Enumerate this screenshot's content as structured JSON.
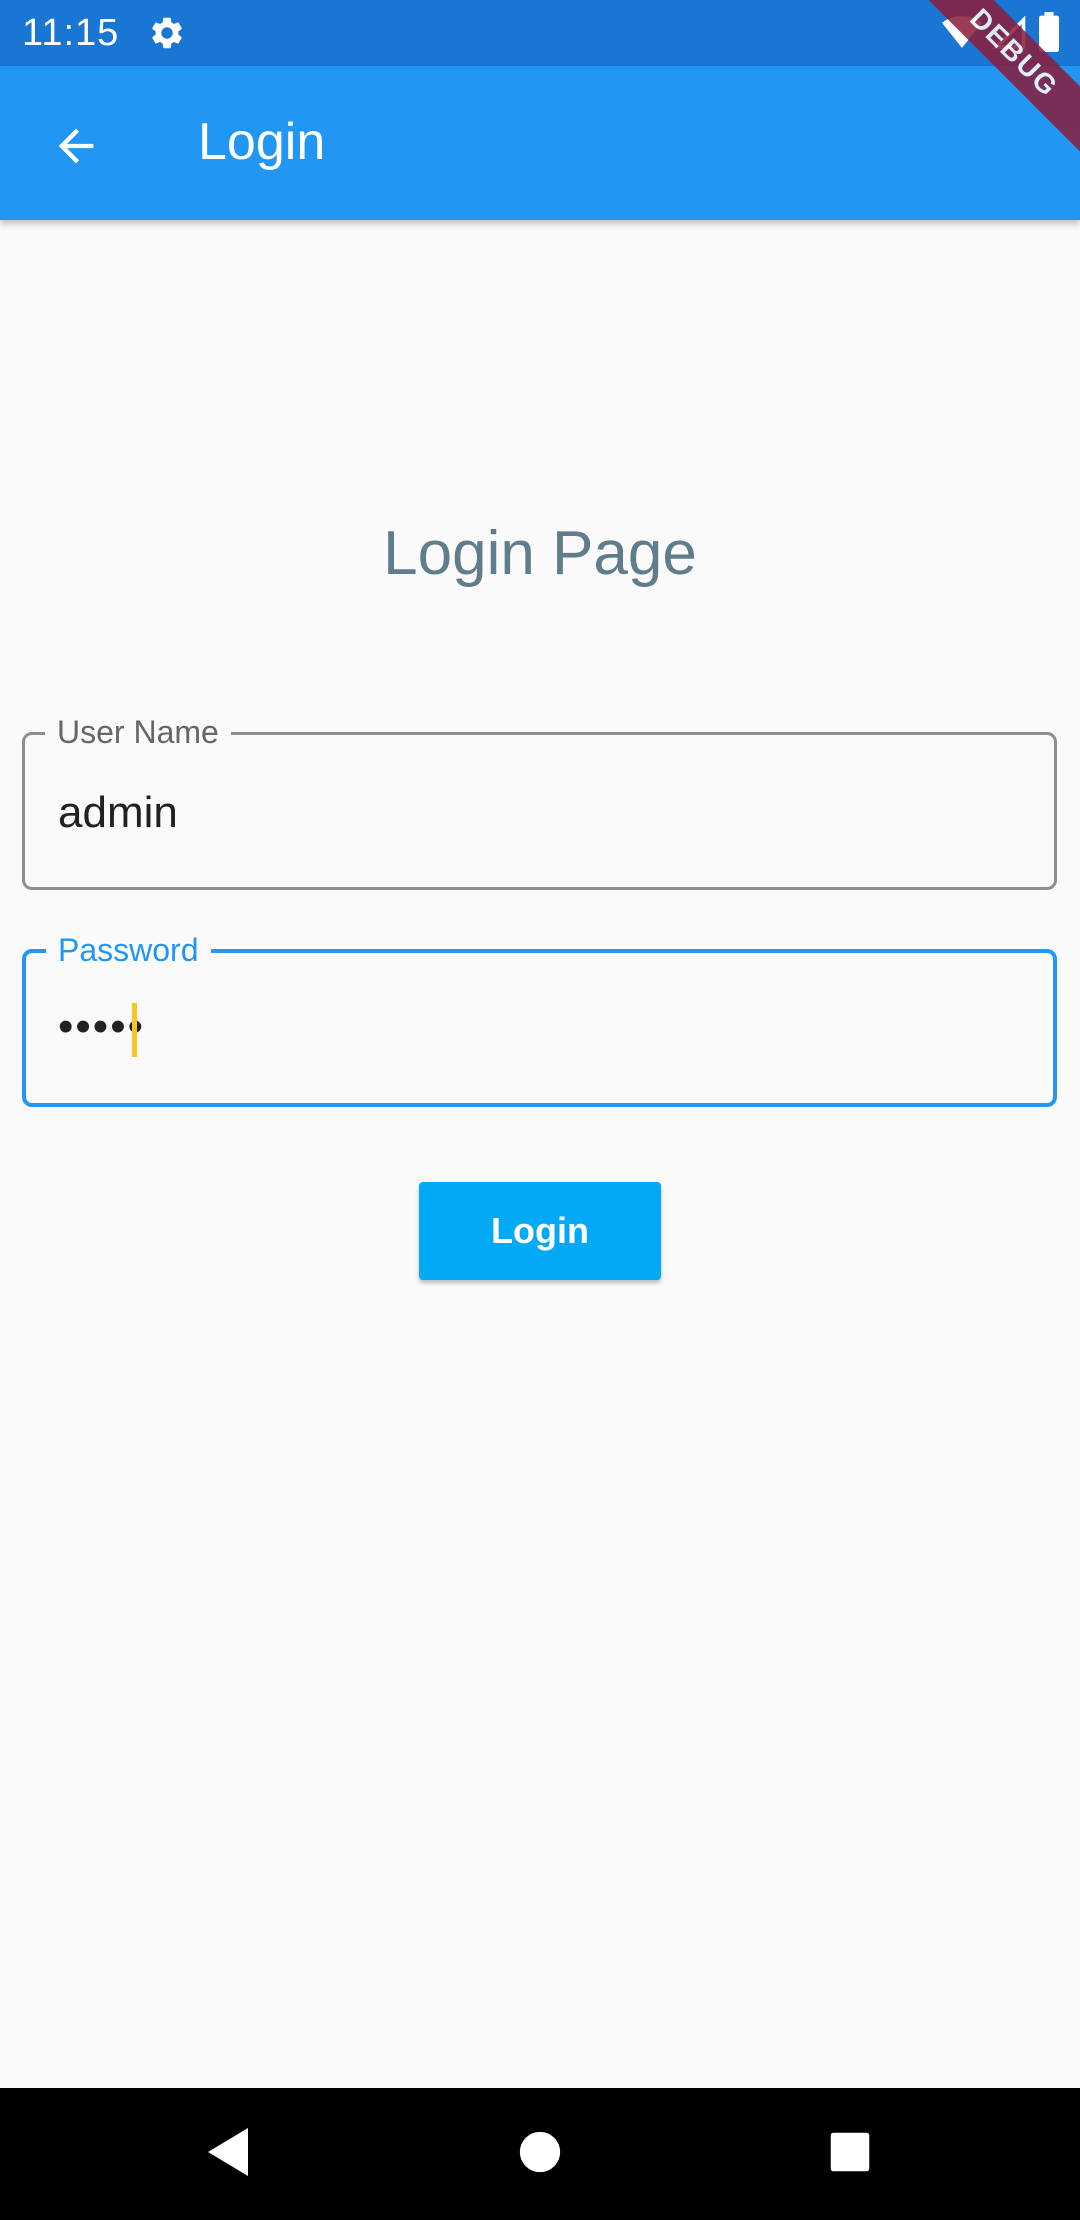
{
  "status_bar": {
    "time": "11:15",
    "icons": [
      "gear-icon",
      "wifi-icon",
      "cell-signal-icon",
      "battery-icon"
    ]
  },
  "debug_banner": {
    "label": "DEBUG"
  },
  "app_bar": {
    "title": "Login",
    "back_icon": "arrow-back-icon"
  },
  "main": {
    "heading": "Login Page",
    "username": {
      "label": "User Name",
      "value": "admin"
    },
    "password": {
      "label": "Password",
      "value": "•••••"
    },
    "login_button": "Login"
  },
  "nav_bar": {
    "icons": [
      "nav-back-icon",
      "nav-home-icon",
      "nav-recents-icon"
    ]
  },
  "colors": {
    "status_bar": "#1976d2",
    "app_bar": "#2196f3",
    "button": "#03a9f4",
    "heading": "#607d8b",
    "cursor": "#f9c424",
    "debug_banner": "#8b1c3a"
  }
}
